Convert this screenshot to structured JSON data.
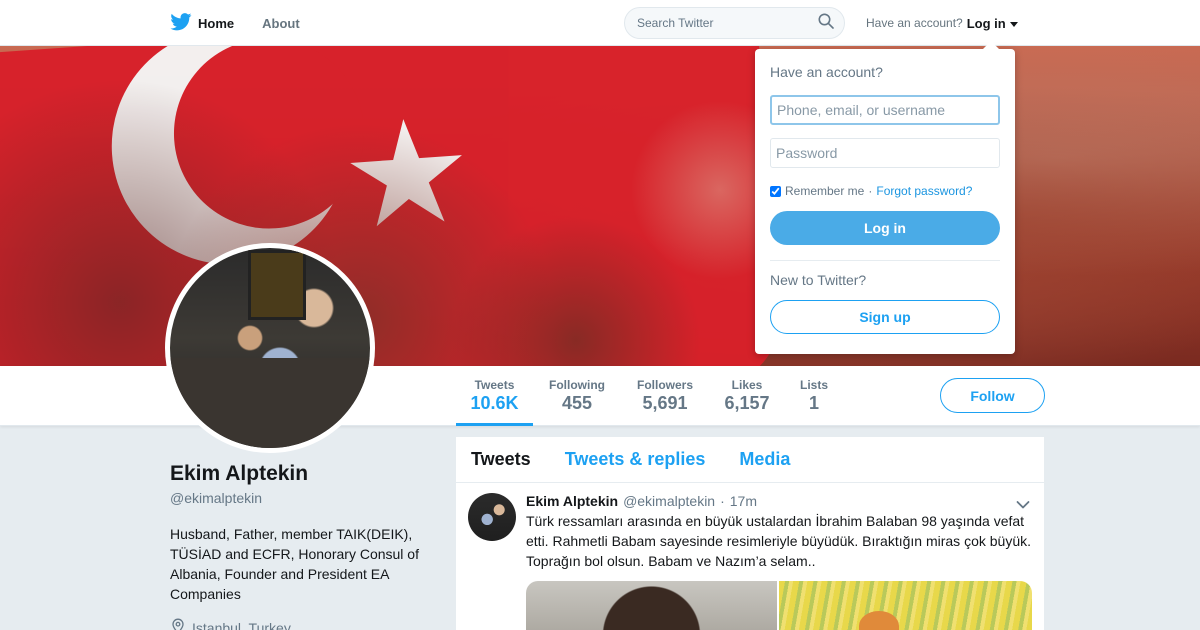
{
  "nav": {
    "home_label": "Home",
    "about_label": "About",
    "search_placeholder": "Search Twitter",
    "have_account_text": "Have an account?",
    "login_label": "Log in"
  },
  "stats": [
    {
      "label": "Tweets",
      "value": "10.6K",
      "active": true
    },
    {
      "label": "Following",
      "value": "455"
    },
    {
      "label": "Followers",
      "value": "5,691"
    },
    {
      "label": "Likes",
      "value": "6,157"
    },
    {
      "label": "Lists",
      "value": "1"
    }
  ],
  "follow_label": "Follow",
  "profile": {
    "name": "Ekim Alptekin",
    "handle": "@ekimalptekin",
    "bio": "Husband, Father, member TAIK(DEIK), TÜSİAD and ECFR, Honorary Consul of Albania, Founder and President EA Companies",
    "location": "Istanbul, Turkey"
  },
  "timeline": {
    "tabs": [
      "Tweets",
      "Tweets & replies",
      "Media"
    ],
    "tweet": {
      "name": "Ekim Alptekin",
      "handle": "@ekimalptekin",
      "separator": "·",
      "time": "17m",
      "text": "Türk ressamları arasında en büyük ustalardan İbrahim Balaban 98 yaşında vefat etti. Rahmetli Babam sayesinde resimleriyle büyüdük. Bıraktığın miras çok büyük. Toprağın bol olsun. Babam ve Nazım’a selam.."
    }
  },
  "login": {
    "title": "Have an account?",
    "username_placeholder": "Phone, email, or username",
    "password_placeholder": "Password",
    "remember_label": "Remember me",
    "separator": "·",
    "forgot_label": "Forgot password?",
    "login_button": "Log in",
    "new_text": "New to Twitter?",
    "signup_button": "Sign up"
  },
  "colors": {
    "accent": "#1da1f2",
    "login_button": "#4aabe7",
    "page_bg": "#e6ecf0"
  },
  "icons": [
    "twitter-bird-icon",
    "search-icon",
    "location-pin-icon",
    "chevron-down-icon"
  ]
}
